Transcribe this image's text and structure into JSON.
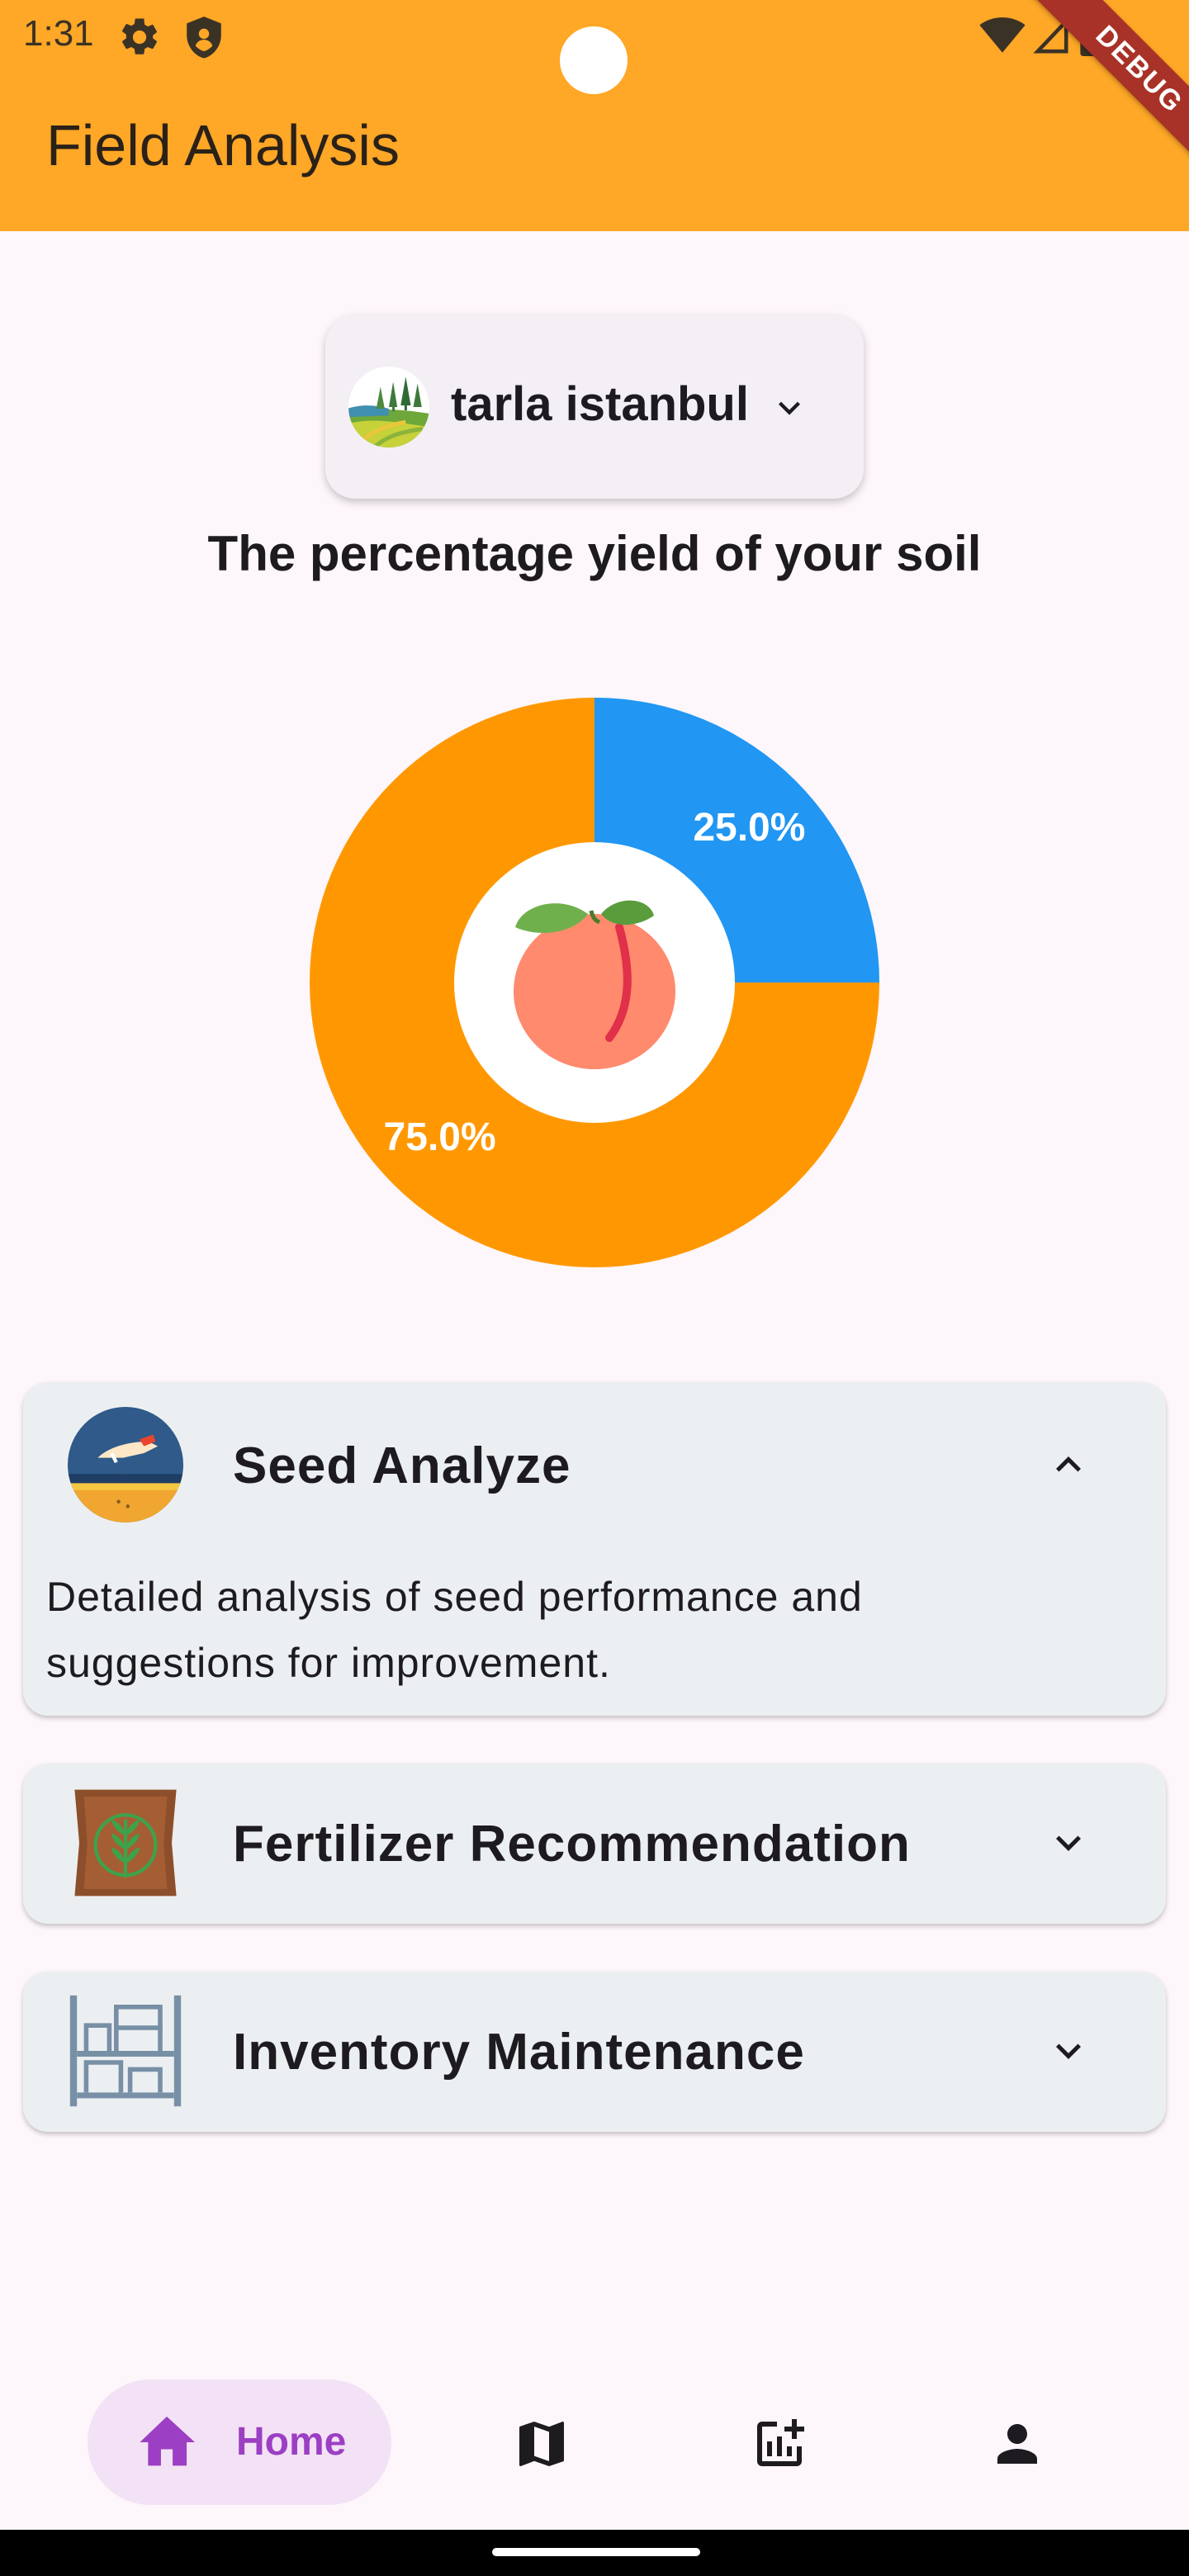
{
  "status_bar": {
    "time": "1:31"
  },
  "debug_banner": "DEBUG",
  "app_bar": {
    "title": "Field Analysis"
  },
  "field_selector": {
    "selected": "tarla istanbul"
  },
  "chart_heading": "The percentage yield of your soil",
  "chart_data": {
    "type": "pie",
    "categories": [
      "",
      ""
    ],
    "values": [
      25.0,
      75.0
    ],
    "labels": [
      "25.0%",
      "75.0%"
    ],
    "colors": [
      "#2196f3",
      "#ff9800"
    ],
    "hole": true,
    "center_icon": "peach-icon"
  },
  "cards": [
    {
      "title": "Seed Analyze",
      "icon": "seed-hand-icon",
      "expanded": true,
      "description": "Detailed analysis of seed performance and suggestions for improvement."
    },
    {
      "title": "Fertilizer Recommendation",
      "icon": "fertilizer-bag-icon",
      "expanded": false
    },
    {
      "title": "Inventory Maintenance",
      "icon": "shelves-icon",
      "expanded": false
    }
  ],
  "bottom_nav": {
    "items": [
      {
        "label": "Home",
        "icon": "home-icon",
        "active": true
      },
      {
        "icon": "map-icon"
      },
      {
        "icon": "add-chart-icon"
      },
      {
        "icon": "person-icon"
      }
    ],
    "active_color": "#9c3fc4"
  }
}
